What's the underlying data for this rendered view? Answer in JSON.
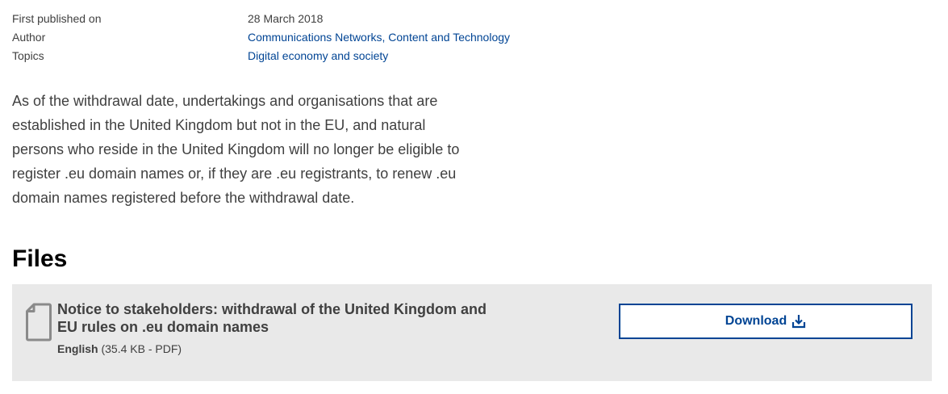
{
  "metadata": {
    "rows": [
      {
        "key": "First published on",
        "value": "28 March 2018"
      },
      {
        "key": "Author",
        "value": "Communications Networks, Content and Technology"
      },
      {
        "key": "Topics",
        "value": "Digital economy and society"
      }
    ]
  },
  "intro": {
    "text": "As of the withdrawal date, undertakings and organisations that are established in the United Kingdom but not in the EU, and natural persons who reside in the United Kingdom will no longer be eligible to register .eu domain names or, if they are .eu registrants, to renew .eu domain names registered before the withdrawal date."
  },
  "files": {
    "heading": "Files",
    "items": [
      {
        "icon": "file-icon",
        "title": "Notice to stakeholders: withdrawal of the United Kingdom and EU rules on .eu domain names",
        "language": "English",
        "details": "(35.4 KB - PDF)",
        "download_label": "Download",
        "download_icon": "download-icon"
      }
    ]
  },
  "colors": {
    "link": "#004494",
    "text": "#404040",
    "card_bg": "#e9e9e9"
  }
}
